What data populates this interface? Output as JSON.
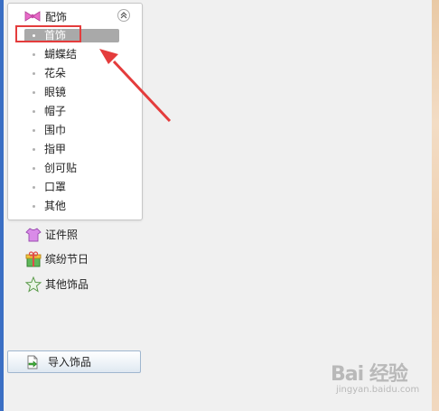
{
  "sidebar": {
    "expanded_category": {
      "label": "配饰",
      "icon": "bow-icon",
      "collapse_icon": "collapse-up-icon",
      "subitems": [
        {
          "label": "首饰",
          "selected": true
        },
        {
          "label": "蝴蝶结",
          "selected": false
        },
        {
          "label": "花朵",
          "selected": false
        },
        {
          "label": "眼镜",
          "selected": false
        },
        {
          "label": "帽子",
          "selected": false
        },
        {
          "label": "围巾",
          "selected": false
        },
        {
          "label": "指甲",
          "selected": false
        },
        {
          "label": "创可贴",
          "selected": false
        },
        {
          "label": "口罩",
          "selected": false
        },
        {
          "label": "其他",
          "selected": false
        }
      ]
    },
    "categories": [
      {
        "label": "证件照",
        "icon": "shirt-icon"
      },
      {
        "label": "缤纷节日",
        "icon": "gift-icon"
      },
      {
        "label": "其他饰品",
        "icon": "star-icon"
      }
    ],
    "import_button": {
      "label": "导入饰品",
      "icon": "import-file-icon"
    }
  },
  "colors": {
    "selected_bg": "#a9a9a9",
    "highlight_box": "#e43c3c",
    "left_strip": "#3b6fc4"
  },
  "watermark": {
    "brand": "Bai 经验",
    "sub": "jingyan.baidu.com"
  }
}
